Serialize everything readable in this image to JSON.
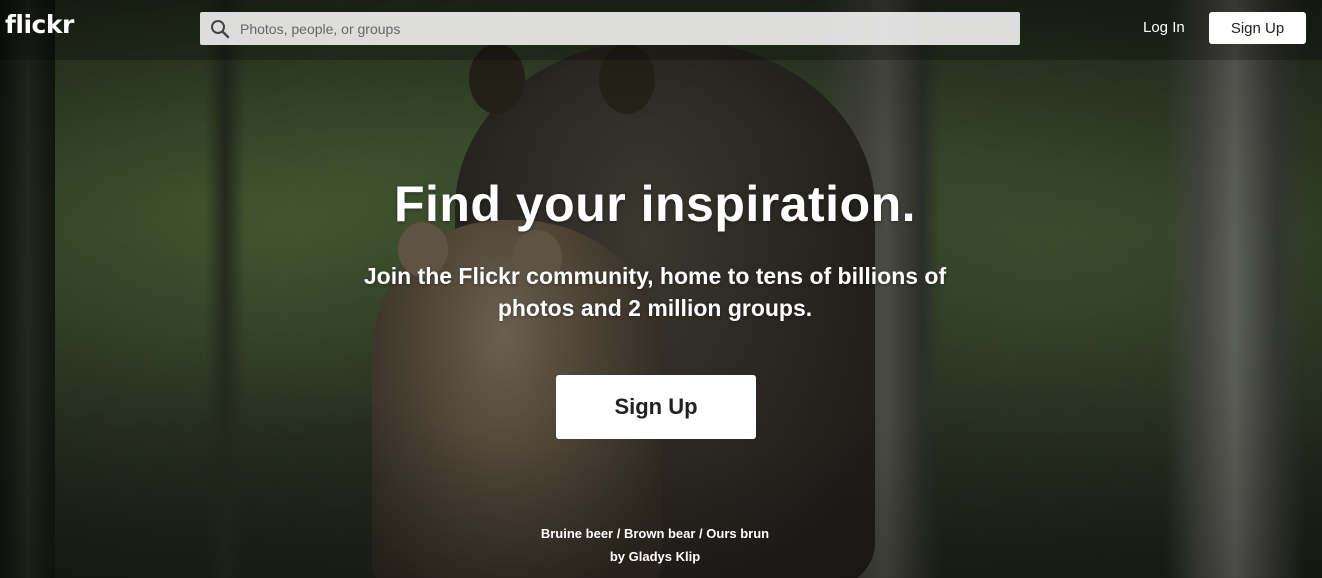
{
  "header": {
    "logo": "flickr",
    "search_placeholder": "Photos, people, or groups",
    "login_label": "Log In",
    "signup_label": "Sign Up"
  },
  "hero": {
    "title": "Find your inspiration.",
    "subtitle": "Join the Flickr community, home to tens of billions of photos and 2 million groups.",
    "signup_label": "Sign Up"
  },
  "photo_credit": {
    "title": "Bruine beer / Brown bear / Ours brun",
    "author": "by Gladys Klip"
  },
  "colors": {
    "button_bg": "#ffffff",
    "button_text": "#212124",
    "text": "#ffffff"
  },
  "icons": {
    "search": "search-icon"
  }
}
